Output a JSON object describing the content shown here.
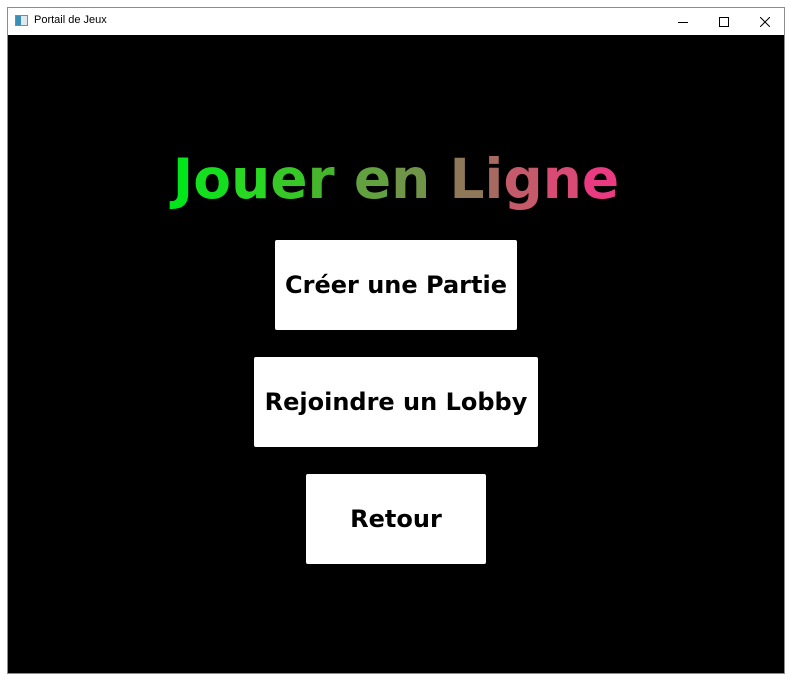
{
  "window": {
    "title": "Portail de Jeux",
    "controls": {
      "minimize_icon": "minimize-icon",
      "maximize_icon": "maximize-icon",
      "close_icon": "close-icon"
    }
  },
  "screen": {
    "background": "#000000",
    "title_letters": [
      {
        "char": "J",
        "color": "#00e61a"
      },
      {
        "char": "o",
        "color": "#14df1e"
      },
      {
        "char": "u",
        "color": "#28d822"
      },
      {
        "char": "e",
        "color": "#37c727"
      },
      {
        "char": "r",
        "color": "#45b52c"
      },
      {
        "char": " ",
        "color": "#000000"
      },
      {
        "char": "e",
        "color": "#62a040"
      },
      {
        "char": "n",
        "color": "#719548"
      },
      {
        "char": " ",
        "color": "#000000"
      },
      {
        "char": "L",
        "color": "#8f7858"
      },
      {
        "char": "i",
        "color": "#a86a60"
      },
      {
        "char": "g",
        "color": "#c55a6a"
      },
      {
        "char": "n",
        "color": "#d84b75"
      },
      {
        "char": "e",
        "color": "#ea3a82"
      }
    ],
    "buttons": {
      "create": "Créer une Partie",
      "join": "Rejoindre un Lobby",
      "back": "Retour"
    }
  }
}
